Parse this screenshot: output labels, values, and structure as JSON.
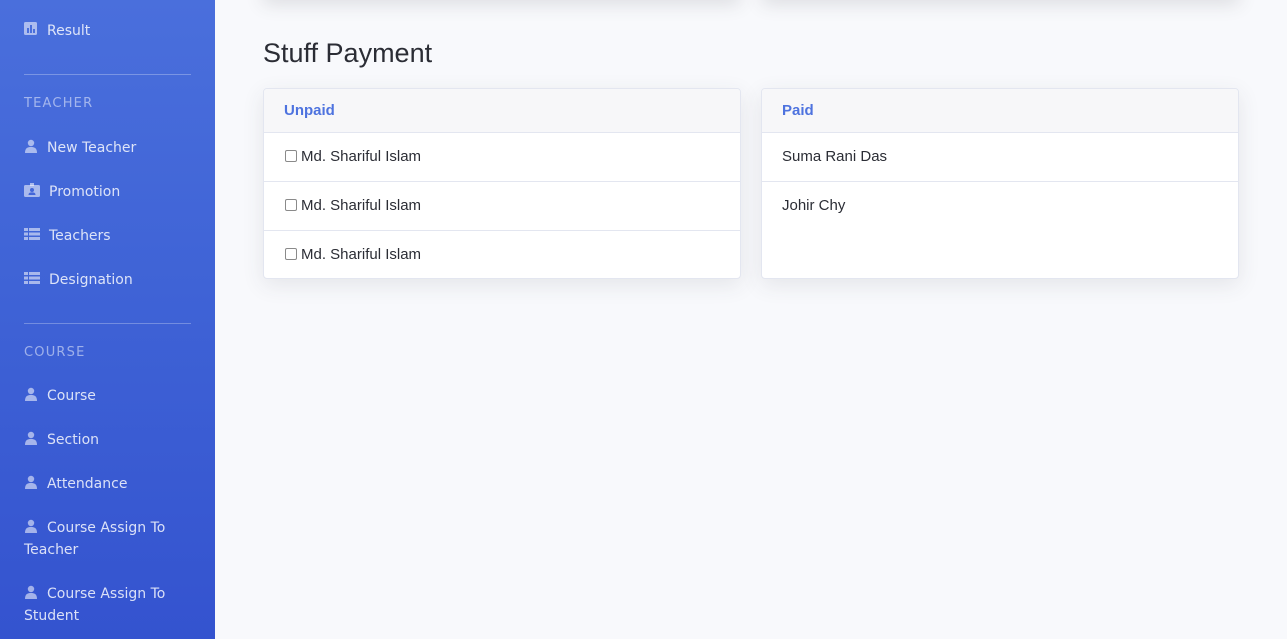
{
  "sidebar": {
    "items_top": [
      {
        "label": "Result",
        "icon": "chart-icon"
      }
    ],
    "teacher_heading": "TEACHER",
    "teacher_items": [
      {
        "label": "New Teacher",
        "icon": "user-icon"
      },
      {
        "label": "Promotion",
        "icon": "id-card-icon"
      },
      {
        "label": "Teachers",
        "icon": "list-icon"
      },
      {
        "label": "Designation",
        "icon": "list-icon"
      }
    ],
    "course_heading": "COURSE",
    "course_items": [
      {
        "label": "Course",
        "icon": "user-icon"
      },
      {
        "label": "Section",
        "icon": "user-icon"
      },
      {
        "label": "Attendance",
        "icon": "user-icon"
      },
      {
        "label_line1": "Course Assign To",
        "label_line2": "Teacher",
        "icon": "user-icon"
      },
      {
        "label_line1": "Course Assign To",
        "label_line2": "Student",
        "icon": "user-icon"
      }
    ]
  },
  "main": {
    "title": "Stuff Payment",
    "unpaid": {
      "header": "Unpaid",
      "rows": [
        "Md. Shariful Islam",
        "Md. Shariful Islam",
        "Md. Shariful Islam"
      ]
    },
    "paid": {
      "header": "Paid",
      "rows": [
        "Suma Rani Das",
        "Johir Chy"
      ]
    }
  },
  "colors": {
    "accent": "#4e73df",
    "sidebar_top": "#4a6fdc",
    "sidebar_bottom": "#3453cf"
  }
}
